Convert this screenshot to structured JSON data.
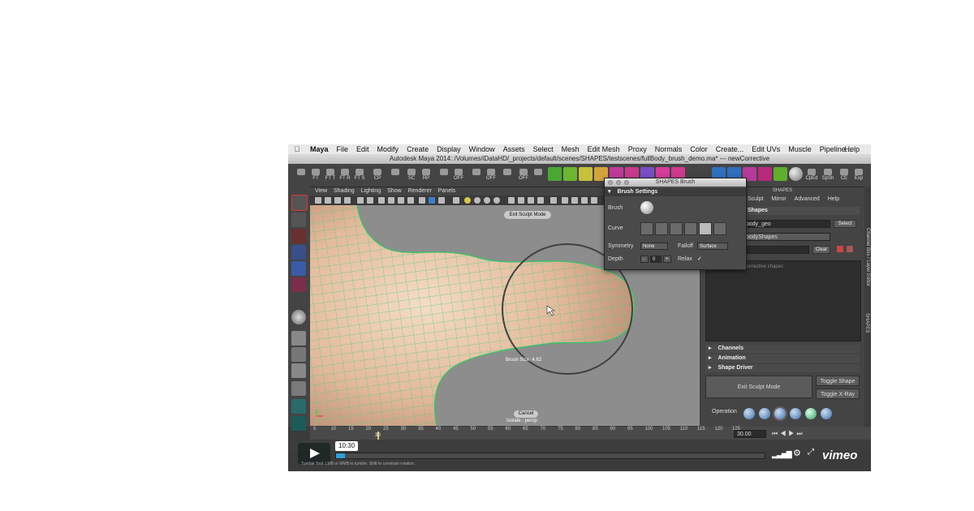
{
  "menubar": {
    "app": "Maya",
    "items": [
      "File",
      "Edit",
      "Modify",
      "Create",
      "Display",
      "Window",
      "Assets",
      "Select",
      "Mesh",
      "Edit Mesh",
      "Proxy",
      "Normals",
      "Color",
      "Create...",
      "Edit UVs",
      "Muscle",
      "Pipeline..."
    ],
    "help": "Help"
  },
  "window_title": "Autodesk Maya 2014: /Volumes/iDataHD/_projects/default/scenes/SHAPES/testscenes/fullBody_brush_demo.ma* --- newCorrective",
  "shelf": {
    "labels": [
      "FT",
      "FT T",
      "FT R",
      "FT S",
      "CP",
      "",
      "SC",
      "RP",
      "",
      "OFF",
      "",
      "OFF",
      "",
      "OFF",
      "",
      "NAME",
      "",
      "",
      "",
      "",
      "",
      "",
      "",
      "",
      "",
      "",
      "",
      "",
      "",
      "",
      "",
      "",
      "",
      "",
      "",
      "CpEd",
      "SpSh",
      "CE",
      "Exp"
    ]
  },
  "viewport": {
    "menu": [
      "View",
      "Shading",
      "Lighting",
      "Show",
      "Renderer",
      "Panels"
    ],
    "exit_sculpt_pill": "Exit Sculpt Mode",
    "brush_size_label": "Brush Size: 4.62",
    "cancel_pill": "Cancel",
    "isolate_label": "Isolate : persp"
  },
  "brush_window": {
    "title": "SHAPES Brush",
    "section": "Brush Settings",
    "brush_label": "Brush",
    "curve_label": "Curve",
    "symmetry_label": "Symmetry",
    "symmetry_value": "None",
    "falloff_label": "Falloff",
    "falloff_value": "Surface",
    "depth_label": "Depth",
    "depth_value": "0",
    "relax_label": "Relax",
    "relax_checked": "✓"
  },
  "shapes_panel": {
    "title": "SHAPES",
    "menu": [
      "Sculpt",
      "Mirror",
      "Advanced",
      "Help"
    ],
    "section": "Shapes",
    "mesh_field": "body_geo",
    "select_button": "Select",
    "blend_field": "bodyShapes",
    "clear_button": "Clear",
    "list_hint": "corrective shapes",
    "rows": [
      "Channels",
      "Animation",
      "Shape Driver"
    ],
    "exit_sculpt_button": "Exit Sculpt Mode",
    "toggle_shape_button": "Toggle Shape",
    "toggle_xray_button": "Toggle X-Ray",
    "operation_label": "Operation"
  },
  "side_tabs": {
    "channel_box": "Channel Box / Layer Editor",
    "shapes": "SHAPES"
  },
  "timeline": {
    "ticks": [
      "5",
      "10",
      "15",
      "20",
      "25",
      "30",
      "35",
      "40",
      "45",
      "50",
      "55",
      "60",
      "65",
      "70",
      "75",
      "80",
      "85",
      "90",
      "95",
      "100",
      "105",
      "110",
      "115",
      "120",
      "125"
    ],
    "current_frame": "30",
    "end_field": "30.00"
  },
  "video": {
    "time": "10:30",
    "progress": 0.02,
    "status_text": "Tumble Tool: LMB or MMB to tumble. Shift to constrain rotation.",
    "brand": "vimeo",
    "accent": "#2ba1d9"
  }
}
